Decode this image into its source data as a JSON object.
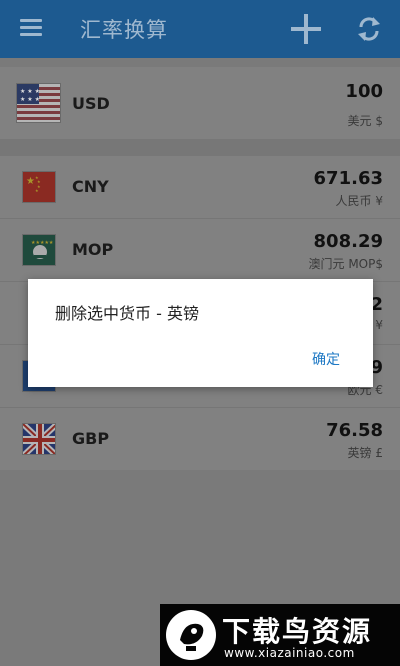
{
  "appbar": {
    "title": "汇率换算",
    "icons": [
      "menu-icon",
      "add-icon",
      "refresh-icon"
    ]
  },
  "base": {
    "code": "USD",
    "amount": "100",
    "sub": "美元 $",
    "flag": "us-flag-icon"
  },
  "currencies": [
    {
      "code": "CNY",
      "amount": "671.63",
      "sub": "人民币 ¥",
      "flag": "cn-flag-icon"
    },
    {
      "code": "MOP",
      "amount": "808.29",
      "sub": "澳门元 MOP$",
      "flag": "mo-flag-icon"
    },
    {
      "code": "",
      "amount": "2",
      "sub": "¥",
      "flag": ""
    },
    {
      "code": "",
      "amount": "9",
      "sub": "欧元 €",
      "flag": "eu-flag-icon"
    },
    {
      "code": "GBP",
      "amount": "76.58",
      "sub": "英镑 £",
      "flag": "gb-flag-icon"
    }
  ],
  "dialog": {
    "message": "删除选中货币 - 英镑",
    "ok_label": "确定"
  },
  "watermark": {
    "title": "下载鸟资源",
    "url": "www.xiazainiao.com"
  },
  "colors": {
    "appbar": "#1d5a90",
    "dim_overlay": "#7a7a7a",
    "dialog_button": "#1d78c4"
  }
}
